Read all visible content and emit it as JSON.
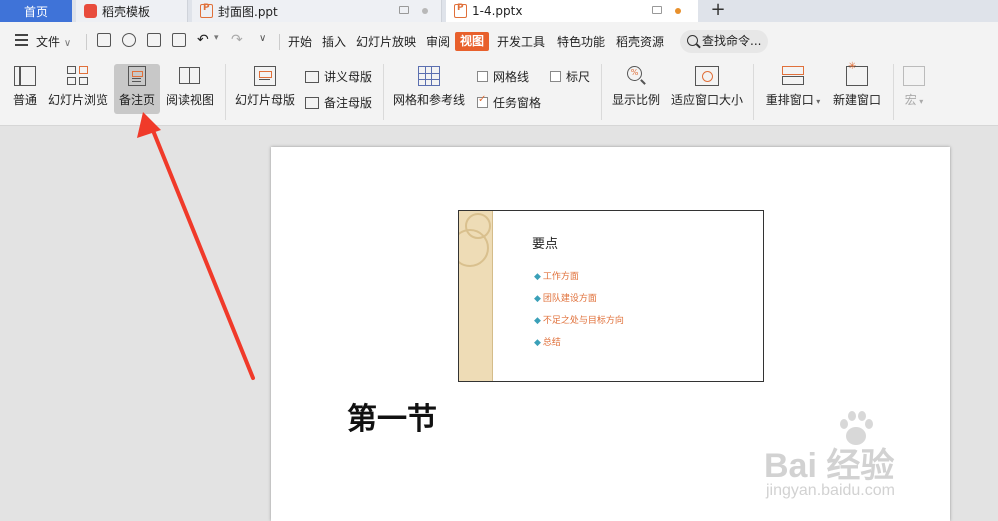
{
  "tabs": [
    {
      "label": "首页",
      "kind": "home"
    },
    {
      "label": "稻壳模板",
      "kind": "normal"
    },
    {
      "label": "封面图.ppt",
      "kind": "normal"
    },
    {
      "label": "1-4.pptx",
      "kind": "active"
    }
  ],
  "menubar": {
    "file_label": "文件",
    "menus": [
      "开始",
      "插入",
      "幻灯片放映",
      "审阅",
      "视图",
      "开发工具",
      "特色功能",
      "稻壳资源"
    ],
    "active_menu": "视图",
    "search_label": "查找命令..."
  },
  "ribbon": {
    "normal": "普通",
    "slide_sorter": "幻灯片浏览",
    "notes_page": "备注页",
    "reading_view": "阅读视图",
    "slide_master": "幻灯片母版",
    "handout_master": "讲义母版",
    "notes_master": "备注母版",
    "grid_guides": "网格和参考线",
    "gridlines": "网格线",
    "ruler": "标尺",
    "task_pane": "任务窗格",
    "zoom": "显示比例",
    "fit_window": "适应窗口大小",
    "arrange": "重排窗口",
    "new_window": "新建窗口",
    "macro": "宏"
  },
  "slide": {
    "title": "要点",
    "bullets": [
      "工作方面",
      "团队建设方面",
      "不足之处与目标方向",
      "总结"
    ]
  },
  "notes_text": "第一节",
  "watermark": {
    "logo": "Bai 经验",
    "url": "jingyan.baidu.com"
  },
  "colors": {
    "accent": "#e8602c",
    "home_tab": "#3f73d8",
    "arrow": "#f03a2a"
  }
}
